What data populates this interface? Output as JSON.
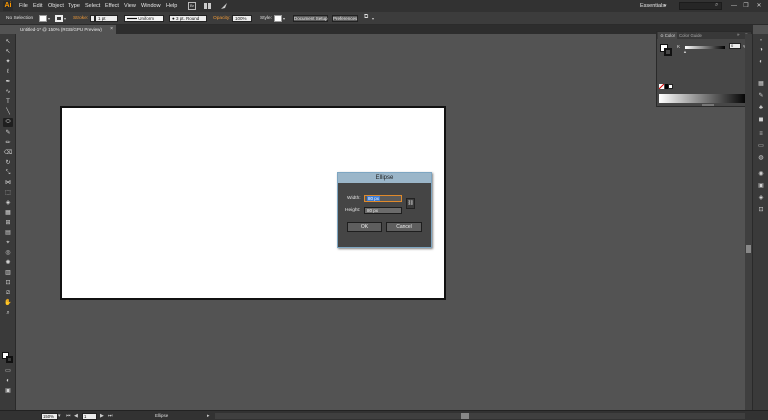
{
  "app": {
    "logo": "Ai",
    "workspace": "Essentials",
    "search_placeholder": ""
  },
  "menu": [
    "File",
    "Edit",
    "Object",
    "Type",
    "Select",
    "Effect",
    "View",
    "Window",
    "Help"
  ],
  "menubar_icons": [
    "Br",
    "arrange-documents-icon",
    "gpu-rocket-icon"
  ],
  "window_controls": [
    "—",
    "❐",
    "✕"
  ],
  "control_bar": {
    "selection_label": "No Selection",
    "stroke_label": "Stroke:",
    "stroke_weight": "1 pt",
    "brush_label": "Uniform",
    "stroke_profile": "3 pt. Round",
    "opacity_label": "Opacity:",
    "opacity_value": "100%",
    "style_label": "Style:",
    "document_setup": "Document Setup",
    "preferences": "Preferences"
  },
  "document_tab": {
    "title": "Untitled-1* @ 150% (RGB/GPU Preview)",
    "close": "×"
  },
  "ellipse_dialog": {
    "title": "Ellipse",
    "width_label": "Width:",
    "width_value": "80 px",
    "height_label": "Height:",
    "height_value": "80 px",
    "ok": "OK",
    "cancel": "Cancel"
  },
  "color_panel": {
    "tabs": [
      "≎ Color",
      "Color Guide"
    ],
    "channel_label": "K",
    "channel_value": "0",
    "percent": "%"
  },
  "status_bar": {
    "zoom": "150%",
    "artboard_number": "1",
    "current_tool": "Ellipse"
  },
  "colors": {
    "accent_orange": "#f09a37",
    "dialog_title": "#9bb6c9",
    "selection_blue": "#3a7bd5"
  }
}
